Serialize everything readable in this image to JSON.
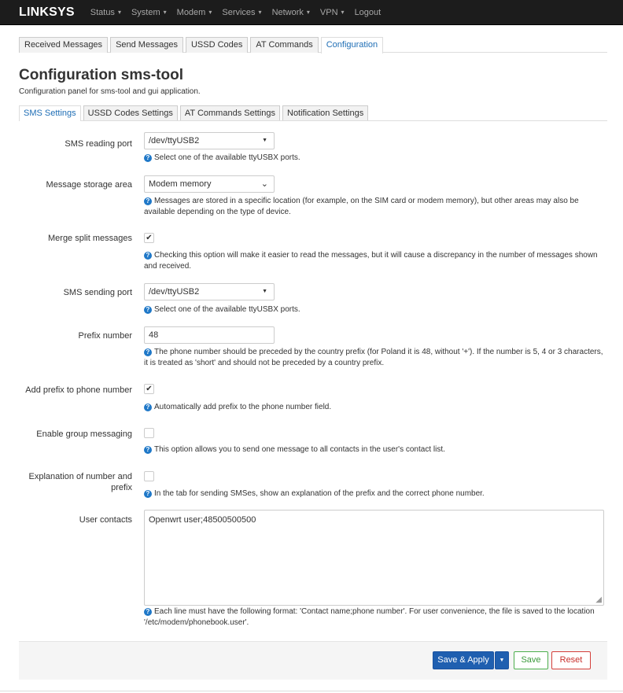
{
  "navbar": {
    "brand": "LINKSYS",
    "menu": [
      {
        "label": "Status",
        "dropdown": true
      },
      {
        "label": "System",
        "dropdown": true
      },
      {
        "label": "Modem",
        "dropdown": true
      },
      {
        "label": "Services",
        "dropdown": true
      },
      {
        "label": "Network",
        "dropdown": true
      },
      {
        "label": "VPN",
        "dropdown": true
      },
      {
        "label": "Logout",
        "dropdown": false
      }
    ]
  },
  "page_tabs": [
    "Received Messages",
    "Send Messages",
    "USSD Codes",
    "AT Commands",
    "Configuration"
  ],
  "page_tab_active": "Configuration",
  "title": "Configuration sms-tool",
  "subtitle": "Configuration panel for sms-tool and gui application.",
  "sub_tabs": [
    "SMS Settings",
    "USSD Codes Settings",
    "AT Commands Settings",
    "Notification Settings"
  ],
  "sub_tab_active": "SMS Settings",
  "fields": {
    "reading_port": {
      "label": "SMS reading port",
      "value": "/dev/ttyUSB2",
      "help": "Select one of the available ttyUSBX ports."
    },
    "storage_area": {
      "label": "Message storage area",
      "value": "Modem memory",
      "help": "Messages are stored in a specific location (for example, on the SIM card or modem memory), but other areas may also be available depending on the type of device."
    },
    "merge_split": {
      "label": "Merge split messages",
      "checked": true,
      "help": "Checking this option will make it easier to read the messages, but it will cause a discrepancy in the number of messages shown and received."
    },
    "sending_port": {
      "label": "SMS sending port",
      "value": "/dev/ttyUSB2",
      "help": "Select one of the available ttyUSBX ports."
    },
    "prefix_number": {
      "label": "Prefix number",
      "value": "48",
      "help": "The phone number should be preceded by the country prefix (for Poland it is 48, without '+'). If the number is 5, 4 or 3 characters, it is treated as 'short' and should not be preceded by a country prefix."
    },
    "add_prefix": {
      "label": "Add prefix to phone number",
      "checked": true,
      "help": "Automatically add prefix to the phone number field."
    },
    "group_messaging": {
      "label": "Enable group messaging",
      "checked": false,
      "help": "This option allows you to send one message to all contacts in the user's contact list."
    },
    "explanation": {
      "label_line1": "Explanation of number and",
      "label_line2": "prefix",
      "checked": false,
      "help": "In the tab for sending SMSes, show an explanation of the prefix and the correct phone number."
    },
    "user_contacts": {
      "label": "User contacts",
      "value": "Openwrt user;48500500500",
      "help": "Each line must have the following format: 'Contact name;phone number'. For user convenience, the file is saved to the location '/etc/modem/phonebook.user'."
    }
  },
  "buttons": {
    "save_apply": "Save & Apply",
    "save": "Save",
    "reset": "Reset"
  },
  "colors": {
    "navbar_bg": "#1c1c1c",
    "accent": "#1f6eb5",
    "primary_button": "#1f5fb0",
    "save_button": "#4cae4c",
    "reset_button": "#d43f3a"
  }
}
